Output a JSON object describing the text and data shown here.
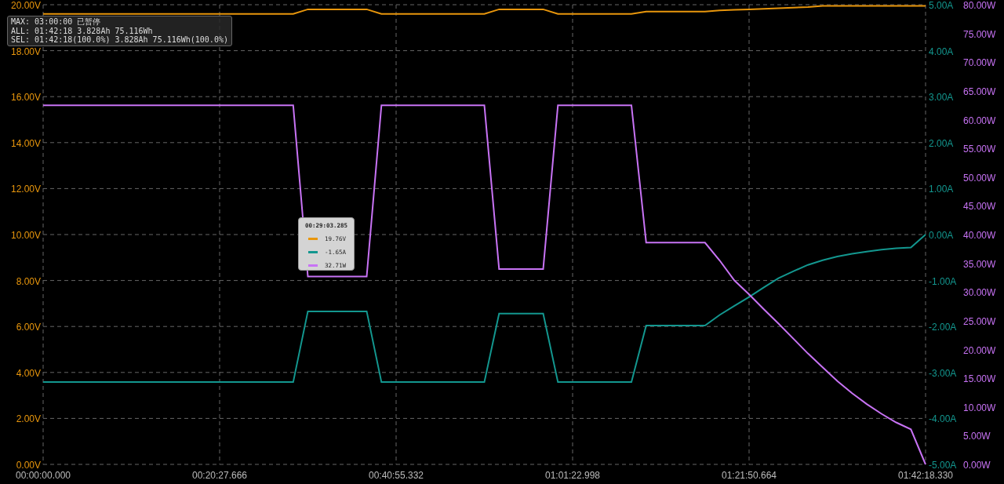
{
  "info_panel": {
    "lines": [
      "MAX: 03:00:00 已暂停",
      "ALL: 01:42:18 3.828Ah 75.116Wh",
      "SEL: 01:42:18(100.0%) 3.828Ah 75.116Wh(100.0%)"
    ]
  },
  "tooltip": {
    "time": "00:29:03.285",
    "items": [
      {
        "value": "19.76V",
        "color": "#e8960c"
      },
      {
        "value": "-1.65A",
        "color": "#13978f"
      },
      {
        "value": "32.71W",
        "color": "#c873f5"
      }
    ]
  },
  "chart_data": {
    "type": "line",
    "grid": true,
    "ylim": [
      0,
      20
    ],
    "categories": [
      "00:00:00.000",
      null,
      null,
      null,
      null,
      null,
      null,
      null,
      null,
      null,
      null,
      null,
      "00:20:27.666",
      null,
      null,
      null,
      null,
      null,
      null,
      null,
      null,
      null,
      null,
      null,
      "00:40:55.332",
      null,
      null,
      null,
      null,
      null,
      null,
      null,
      null,
      null,
      null,
      null,
      "01:01:22.998",
      null,
      null,
      null,
      null,
      null,
      null,
      null,
      null,
      null,
      null,
      null,
      "01:21:50.664",
      null,
      null,
      null,
      null,
      null,
      null,
      null,
      null,
      null,
      null,
      null,
      "01:42:18.330"
    ],
    "y2lim": [
      -5,
      5
    ],
    "y2ticks": [
      {
        "value": -5,
        "label": "-5.00A"
      },
      {
        "value": -4,
        "label": "-4.00A"
      },
      {
        "value": -3,
        "label": "-3.00A"
      },
      {
        "value": -2,
        "label": "-2.00A"
      },
      {
        "value": -1,
        "label": "-1.00A"
      },
      {
        "value": 0,
        "label": "0.00A"
      },
      {
        "value": 1,
        "label": "1.00A"
      },
      {
        "value": 2,
        "label": "2.00A"
      },
      {
        "value": 3,
        "label": "3.00A"
      },
      {
        "value": 4,
        "label": "4.00A"
      },
      {
        "value": 5,
        "label": "5.00A"
      }
    ],
    "y3lim": [
      0,
      80
    ],
    "y3ticks": [
      {
        "value": 0,
        "label": "0.00W"
      },
      {
        "value": 5,
        "label": "5.00W"
      },
      {
        "value": 10,
        "label": "10.00W"
      },
      {
        "value": 15,
        "label": "15.00W"
      },
      {
        "value": 20,
        "label": "20.00W"
      },
      {
        "value": 25,
        "label": "25.00W"
      },
      {
        "value": 30,
        "label": "30.00W"
      },
      {
        "value": 35,
        "label": "35.00W"
      },
      {
        "value": 40,
        "label": "40.00W"
      },
      {
        "value": 45,
        "label": "45.00W"
      },
      {
        "value": 50,
        "label": "50.00W"
      },
      {
        "value": 55,
        "label": "55.00W"
      },
      {
        "value": 60,
        "label": "60.00W"
      },
      {
        "value": 65,
        "label": "65.00W"
      },
      {
        "value": 70,
        "label": "70.00W"
      },
      {
        "value": 75,
        "label": "75.00W"
      },
      {
        "value": 80,
        "label": "80.00W"
      }
    ],
    "yticks": [
      {
        "value": 0,
        "label": "0.00V"
      },
      {
        "value": 2,
        "label": "2.00V"
      },
      {
        "value": 4,
        "label": "4.00V"
      },
      {
        "value": 6,
        "label": "6.00V"
      },
      {
        "value": 8,
        "label": "8.00V"
      },
      {
        "value": 10,
        "label": "10.00V"
      },
      {
        "value": 12,
        "label": "12.00V"
      },
      {
        "value": 14,
        "label": "14.00V"
      },
      {
        "value": 16,
        "label": "16.00V"
      },
      {
        "value": 18,
        "label": "18.00V"
      },
      {
        "value": 20,
        "label": "20.00V"
      }
    ],
    "series": [
      {
        "color": "#e8960c",
        "values": [
          19.6,
          19.6,
          19.6,
          19.6,
          19.6,
          19.6,
          19.6,
          19.6,
          19.6,
          19.6,
          19.6,
          19.6,
          19.6,
          19.6,
          19.6,
          19.6,
          19.6,
          19.6,
          19.8,
          19.8,
          19.8,
          19.8,
          19.8,
          19.6,
          19.6,
          19.6,
          19.6,
          19.6,
          19.6,
          19.6,
          19.6,
          19.8,
          19.8,
          19.8,
          19.8,
          19.6,
          19.6,
          19.6,
          19.6,
          19.6,
          19.6,
          19.7,
          19.7,
          19.7,
          19.7,
          19.7,
          19.75,
          19.78,
          19.8,
          19.82,
          19.85,
          19.87,
          19.9,
          19.95,
          19.95,
          19.95,
          19.95,
          19.95,
          19.95,
          19.95,
          19.95
        ]
      },
      {
        "axis": "y2",
        "color": "#13978f",
        "values": [
          -3.21,
          -3.21,
          -3.21,
          -3.21,
          -3.21,
          -3.21,
          -3.21,
          -3.21,
          -3.21,
          -3.21,
          -3.21,
          -3.21,
          -3.21,
          -3.21,
          -3.21,
          -3.21,
          -3.21,
          -3.21,
          -1.67,
          -1.67,
          -1.67,
          -1.67,
          -1.67,
          -3.21,
          -3.21,
          -3.21,
          -3.21,
          -3.21,
          -3.21,
          -3.21,
          -3.21,
          -1.72,
          -1.72,
          -1.72,
          -1.72,
          -3.21,
          -3.21,
          -3.21,
          -3.21,
          -3.21,
          -3.21,
          -1.98,
          -1.98,
          -1.98,
          -1.98,
          -1.98,
          -1.75,
          -1.55,
          -1.36,
          -1.15,
          -0.95,
          -0.8,
          -0.66,
          -0.56,
          -0.48,
          -0.42,
          -0.37,
          -0.33,
          -0.3,
          -0.28,
          0
        ]
      },
      {
        "axis": "y3",
        "color": "#c873f5",
        "values": [
          62.5,
          62.5,
          62.5,
          62.5,
          62.5,
          62.5,
          62.5,
          62.5,
          62.5,
          62.5,
          62.5,
          62.5,
          62.5,
          62.5,
          62.5,
          62.5,
          62.5,
          62.5,
          32.7,
          32.7,
          32.7,
          32.7,
          32.7,
          62.5,
          62.5,
          62.5,
          62.5,
          62.5,
          62.5,
          62.5,
          62.5,
          34,
          34,
          34,
          34,
          62.5,
          62.5,
          62.5,
          62.5,
          62.5,
          62.5,
          38.6,
          38.6,
          38.6,
          38.6,
          38.6,
          35.5,
          32,
          29.6,
          27,
          24.5,
          21.9,
          19.3,
          16.9,
          14.5,
          12.4,
          10.5,
          8.8,
          7.3,
          6.1,
          0
        ]
      }
    ]
  }
}
